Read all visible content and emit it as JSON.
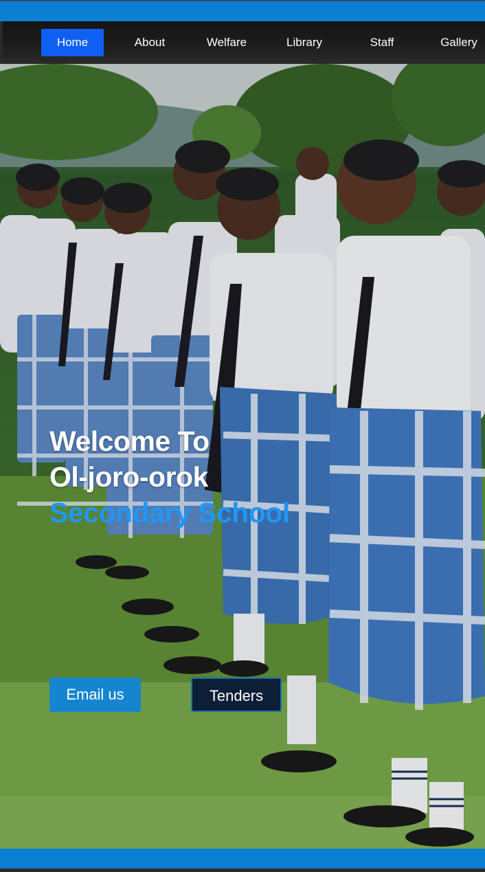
{
  "nav": {
    "items": [
      {
        "label": "Home",
        "active": true
      },
      {
        "label": "About"
      },
      {
        "label": "Welfare"
      },
      {
        "label": "Library"
      },
      {
        "label": "Staff"
      },
      {
        "label": "Gallery"
      }
    ]
  },
  "hero": {
    "title_line1": "Welcome To",
    "title_line2": "Ol-joro-orok",
    "title_line3": "Secondary School"
  },
  "buttons": {
    "email": "Email us",
    "tenders": "Tenders"
  },
  "colors": {
    "accent_blue": "#0b7fd1",
    "active_nav": "#0f5ff2",
    "title_highlight": "#2196f3"
  }
}
